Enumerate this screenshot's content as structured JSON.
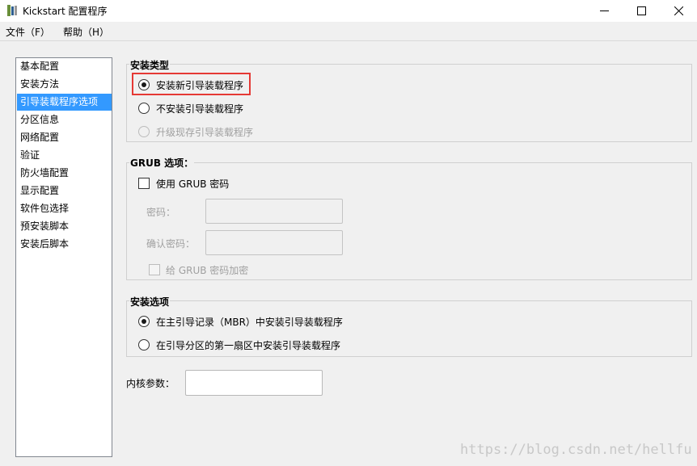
{
  "window": {
    "title": "Kickstart 配置程序",
    "controls": {
      "minimize": "minimize-icon",
      "maximize": "maximize-icon",
      "close": "close-icon"
    }
  },
  "menu": [
    {
      "label": "文件（F）"
    },
    {
      "label": "帮助（H）"
    }
  ],
  "sidebar": {
    "items": [
      {
        "label": "基本配置",
        "selected": false
      },
      {
        "label": "安装方法",
        "selected": false
      },
      {
        "label": "引导装载程序选项",
        "selected": true
      },
      {
        "label": "分区信息",
        "selected": false
      },
      {
        "label": "网络配置",
        "selected": false
      },
      {
        "label": "验证",
        "selected": false
      },
      {
        "label": "防火墙配置",
        "selected": false
      },
      {
        "label": "显示配置",
        "selected": false
      },
      {
        "label": "软件包选择",
        "selected": false
      },
      {
        "label": "预安装脚本",
        "selected": false
      },
      {
        "label": "安装后脚本",
        "selected": false
      }
    ],
    "selected_color": "#3399ff"
  },
  "install_type": {
    "title": "安装类型",
    "options": [
      {
        "label": "安装新引导装载程序",
        "checked": true,
        "disabled": false
      },
      {
        "label": "不安装引导装载程序",
        "checked": false,
        "disabled": false
      },
      {
        "label": "升级现存引导装载程序",
        "checked": false,
        "disabled": true
      }
    ],
    "highlight_color": "#e53935"
  },
  "grub": {
    "title": "GRUB 选项：",
    "use_password_label": "使用  GRUB 密码",
    "use_password_checked": false,
    "password_label": "密码：",
    "password_value": "",
    "confirm_label": "确认密码：",
    "confirm_value": "",
    "encrypt_label": "给  GRUB 密码加密",
    "encrypt_checked": false
  },
  "install_options": {
    "title": "安装选项",
    "options": [
      {
        "label": "在主引导记录（MBR）中安装引导装载程序",
        "checked": true
      },
      {
        "label": "在引导分区的第一扇区中安装引导装载程序",
        "checked": false
      }
    ]
  },
  "kernel": {
    "label": "内核参数：",
    "value": ""
  },
  "watermark": "https://blog.csdn.net/hellfu"
}
